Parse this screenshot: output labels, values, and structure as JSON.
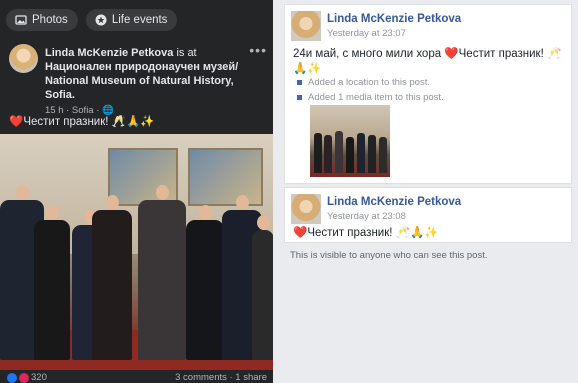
{
  "left_post": {
    "pills": [
      {
        "label": "Photos",
        "icon": "photo-icon"
      },
      {
        "label": "Life events",
        "icon": "star-badge-icon"
      }
    ],
    "author": "Linda McKenzie Petkova",
    "at_text": "is at",
    "location": "Национален природонаучен музей/ National Museum of Natural History, Sofia.",
    "meta": "15 h · Sofia · ",
    "caption": "❤️Честит празник! 🥂🙏✨",
    "reaction_count": "320",
    "comments_shares": "3 comments · 1 share"
  },
  "activity": {
    "entries": [
      {
        "author": "Linda McKenzie Petkova",
        "time": "Yesterday at 23:07",
        "text": "24и май, с много мили хора ❤️Честит празник! 🥂🙏✨",
        "bullets": [
          "Added a location to this post.",
          "Added 1 media item to this post."
        ]
      },
      {
        "author": "Linda McKenzie Petkova",
        "time": "Yesterday at 23:08",
        "text": "❤️Честит празник! 🥂🙏✨"
      }
    ],
    "visibility_note": "This is visible to anyone who can see this post."
  },
  "colors": {
    "dark_bg": "#242526",
    "link_blue": "#365899",
    "heart_red": "#e0245e",
    "like_blue": "#1877f2"
  }
}
